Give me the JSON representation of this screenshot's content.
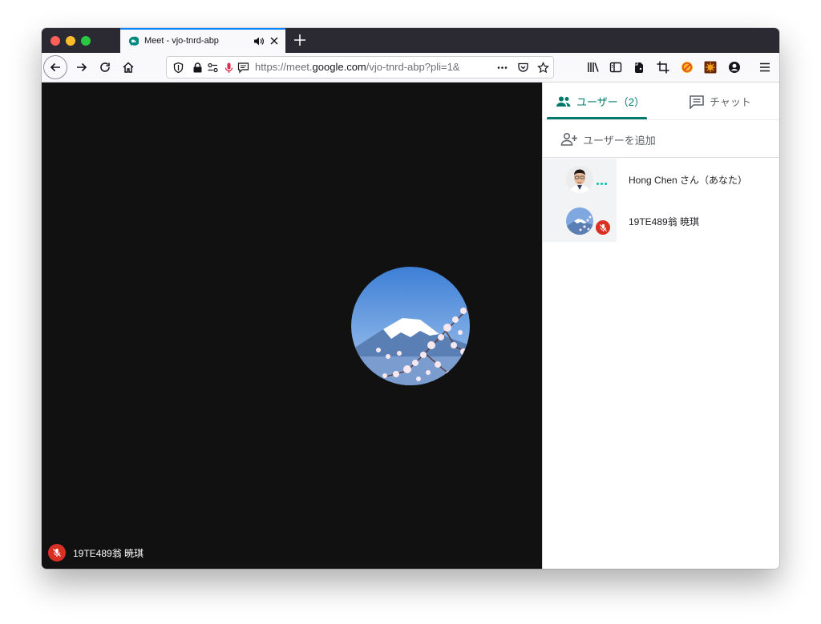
{
  "browser": {
    "tab_title": "Meet - vjo-tnrd-abp",
    "url_domain_prefix": "https://meet.",
    "url_domain": "google.com",
    "url_path": "/vjo-tnrd-abp?pli=1&",
    "accent_color": "#0a84ff",
    "icons": [
      "back-icon",
      "forward-icon",
      "reload-icon",
      "home-icon",
      "shield-icon",
      "lock-icon",
      "permissions-icon",
      "microphone-icon",
      "chat-bubble-icon",
      "more-icon",
      "pocket-icon",
      "star-icon",
      "library-icon",
      "sidebar-icon",
      "evernote-icon",
      "crop-icon",
      "adblock-icon",
      "extension-icon",
      "account-icon",
      "menu-icon"
    ]
  },
  "video": {
    "participant_name": "19TE489翁 暁琪",
    "muted": true,
    "background_color": "#111111"
  },
  "panel": {
    "users_tab_label": "ユーザー（2）",
    "chat_tab_label": "チャット",
    "add_user_label": "ユーザーを追加",
    "accent_color": "#00796b",
    "participants": [
      {
        "name": "Hong Chen さん（あなた）",
        "status": "speaking-dots"
      },
      {
        "name": "19TE489翁 暁琪",
        "status": "muted"
      }
    ]
  }
}
